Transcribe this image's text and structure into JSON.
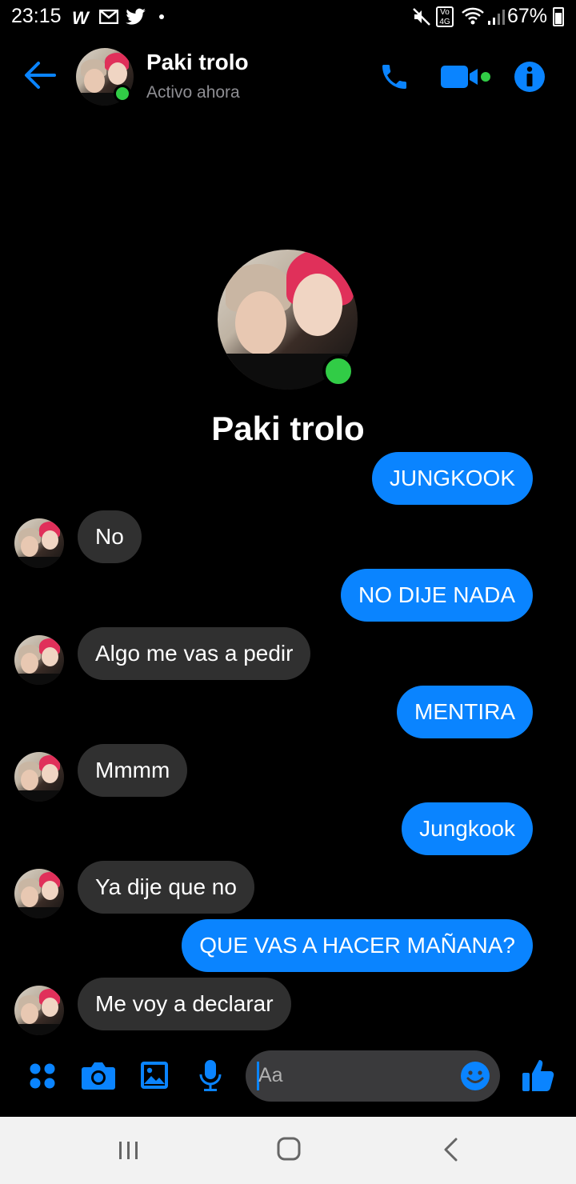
{
  "status_bar": {
    "time": "23:15",
    "battery": "67%",
    "icons": [
      "webtoon-icon",
      "gmail-icon",
      "twitter-icon",
      "mute-icon",
      "volte-icon",
      "wifi-icon",
      "signal-icon",
      "battery-icon"
    ]
  },
  "header": {
    "contact_name": "Paki trolo",
    "contact_status": "Activo ahora",
    "accent_color": "#0a84ff"
  },
  "profile": {
    "name": "Paki trolo"
  },
  "messages": [
    {
      "side": "out",
      "text": "JUNGKOOK"
    },
    {
      "side": "in",
      "text": "No"
    },
    {
      "side": "out",
      "text": "NO DIJE NADA"
    },
    {
      "side": "in",
      "text": "Algo me vas a pedir"
    },
    {
      "side": "out",
      "text": "MENTIRA"
    },
    {
      "side": "in",
      "text": "Mmmm"
    },
    {
      "side": "out",
      "text": "Jungkook"
    },
    {
      "side": "in",
      "text": "Ya dije que no"
    },
    {
      "side": "out",
      "text": "QUE VAS A HACER MAÑANA?"
    },
    {
      "side": "in",
      "text": "Me voy a declarar"
    }
  ],
  "composer": {
    "placeholder": "Aa"
  },
  "colors": {
    "outgoing_bubble": "#0a84ff",
    "incoming_bubble": "#303030",
    "online": "#31cc46"
  }
}
